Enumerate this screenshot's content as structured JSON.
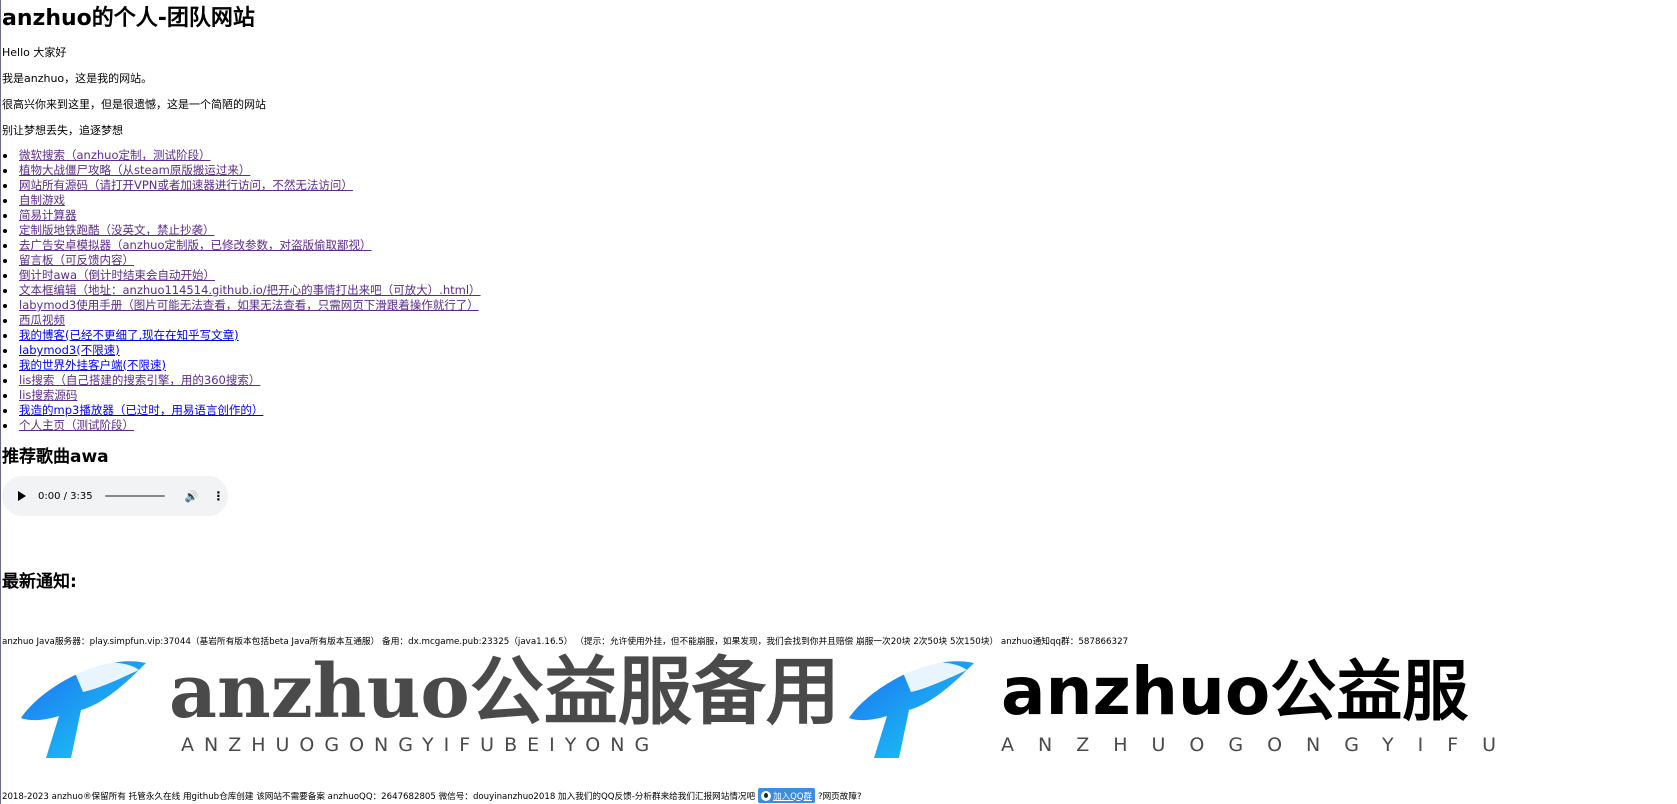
{
  "title": "anzhuo的个人-团队网站",
  "intro": [
    "Hello 大家好",
    "我是anzhuo，这是我的网站。",
    "很高兴你来到这里，但是很遗憾，这是一个简陋的网站",
    "别让梦想丢失，追逐梦想"
  ],
  "links": [
    {
      "label": "微软搜索（anzhuo定制，测试阶段）",
      "visited": true
    },
    {
      "label": "植物大战僵尸攻略（从steam原版搬运过来）",
      "visited": true
    },
    {
      "label": "网站所有源码（请打开VPN或者加速器进行访问，不然无法访问）",
      "visited": true
    },
    {
      "label": "自制游戏",
      "visited": true
    },
    {
      "label": "简易计算器",
      "visited": true
    },
    {
      "label": "定制版地铁跑酷（没英文，禁止抄袭）",
      "visited": true
    },
    {
      "label": "去广告安卓模拟器（anzhuo定制版，已修改参数，对盗版偷取鄙视）",
      "visited": true
    },
    {
      "label": "留言板（可反馈内容）",
      "visited": true
    },
    {
      "label": "倒计时awa（倒计时结束会自动开始）",
      "visited": true
    },
    {
      "label": "文本框编辑（地址：anzhuo114514.github.io/把开心的事情打出来吧（可放大）.html）",
      "visited": true
    },
    {
      "label": "labymod3使用手册（图片可能无法查看，如果无法查看，只需网页下滑跟着操作就行了）",
      "visited": true
    },
    {
      "label": "西瓜视频",
      "visited": true
    },
    {
      "label": "我的博客(已经不更细了,现在在知乎写文章)",
      "visited": false
    },
    {
      "label": "labymod3(不限速)",
      "visited": false
    },
    {
      "label": "我的世界外挂客户端(不限速)",
      "visited": false
    },
    {
      "label": "lis搜索（自己搭建的搜索引擎，用的360搜索）",
      "visited": true
    },
    {
      "label": "lis搜索源码",
      "visited": true
    },
    {
      "label": "我造的mp3播放器（已过时，用易语言创作的）",
      "visited": false
    },
    {
      "label": "个人主页（测试阶段）",
      "visited": true
    }
  ],
  "songs_heading": "推荐歌曲awa",
  "audio": {
    "time": "0:00 / 3:35",
    "play_icon": "play-icon",
    "volume_icon": "volume-icon",
    "more_icon": "more-vert-icon"
  },
  "notice_heading": "最新通知:",
  "notice_text": "anzhuo Java服务器：play.simpfun.vip:37044（基岩所有版本包括beta Java所有版本互通服） 备用：dx.mcgame.pub:23325（java1.16.5） （提示：允许使用外挂，但不能崩服，如果发现，我们会找到你并且赔偿 崩服一次20块 2次50块 5次150块） anzhuo通知qq群：587866327",
  "logos": [
    {
      "big": "anzhuo公益服备用",
      "small": "ANZHUOGONGYIFUBEIYONG"
    },
    {
      "big": "anzhuo公益服",
      "small": "ANZHUOGONGYIFU"
    }
  ],
  "footer": {
    "text_before": "2018-2023 anzhuo®保留所有 托管永久在线 用github仓库创建 该网站不需要备案 anzhuoQQ：2647682805 微信号：douyinanzhuo2018 加入我们的QQ反馈-分析群来给我们汇报网站情况吧",
    "badge": "加入QQ群",
    "text_after": "?网页故障?"
  },
  "colors": {
    "visited_link": "#5b2c8f",
    "link": "#0000ee",
    "logo_blue": "#1e9bf0"
  }
}
